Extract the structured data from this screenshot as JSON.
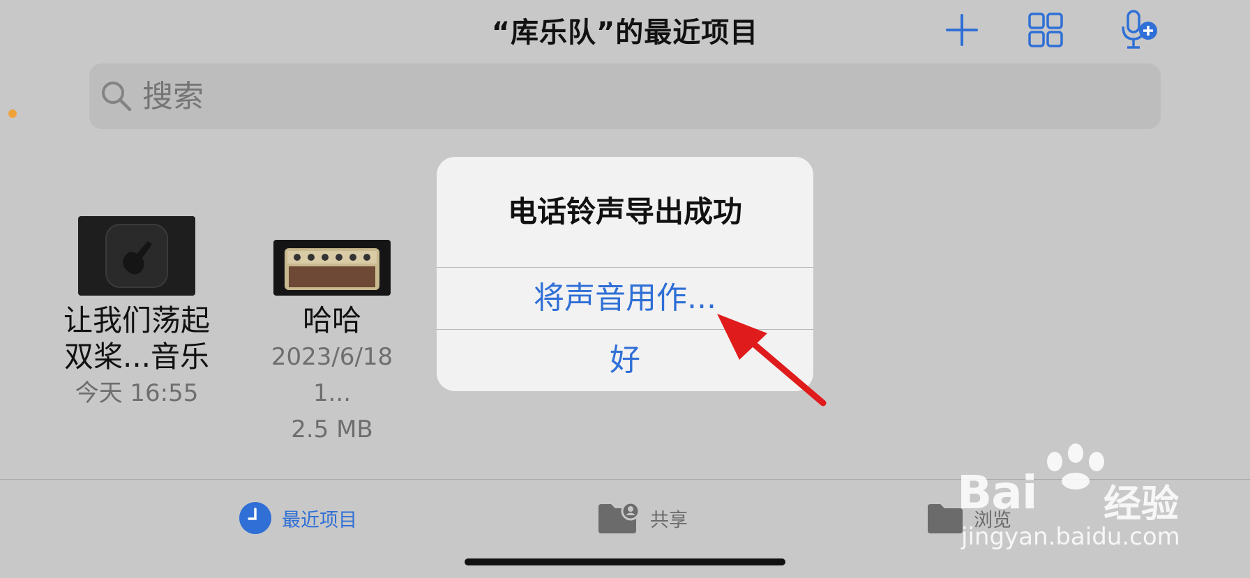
{
  "header": {
    "title": "“库乐队”的最近项目",
    "add_icon": "plus-icon",
    "grid_icon": "grid-view-icon",
    "record_icon": "microphone-add-icon"
  },
  "search": {
    "placeholder": "搜索"
  },
  "files": [
    {
      "name_line1": "让我们荡起",
      "name_line2": "双桨...音乐",
      "meta1": "今天 16:55",
      "thumbnail_icon": "garageband-guitar-icon"
    },
    {
      "name": "哈哈",
      "meta1": "2023/6/18 1...",
      "meta2": "2.5 MB",
      "thumbnail_icon": "amp-thumbnail-icon"
    }
  ],
  "dialog": {
    "title": "电话铃声导出成功",
    "primary_action": "将声音用作...",
    "ok_action": "好"
  },
  "tabbar": {
    "tabs": [
      {
        "label": "最近项目",
        "icon": "clock-icon",
        "active": true
      },
      {
        "label": "共享",
        "icon": "shared-folder-icon",
        "active": false
      },
      {
        "label": "浏览",
        "icon": "folder-icon",
        "active": false
      }
    ]
  },
  "watermark": {
    "brand": "Bai",
    "brand_cn": "经验",
    "url": "jingyan.baidu.com"
  },
  "colors": {
    "accent": "#2f6fd6",
    "arrow": "#e01b1b",
    "background": "#c8c8c8"
  }
}
